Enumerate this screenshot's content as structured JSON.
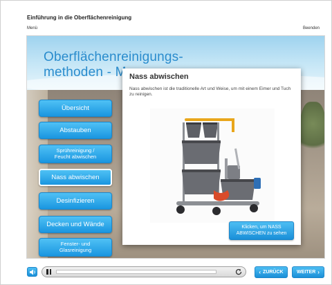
{
  "header": {
    "course_title": "Einführung in die Oberflächenreinigung",
    "menu_label": "Menü",
    "exit_label": "Beenden"
  },
  "stage": {
    "section_title_line1": "Oberflächenreinigungs-",
    "section_title_line2": "methoden - M"
  },
  "nav": {
    "items": [
      {
        "label": "Übersicht",
        "active": false
      },
      {
        "label": "Abstauben",
        "active": false
      },
      {
        "label_line1": "Sprühreinigung /",
        "label_line2": "Feucht abwischen",
        "active": false
      },
      {
        "label": "Nass abwischen",
        "active": true
      },
      {
        "label": "Desinfizieren",
        "active": false
      },
      {
        "label": "Decken und Wände",
        "active": false
      },
      {
        "label_line1": "Fenster- und",
        "label_line2": "Glasreinigung",
        "active": false
      }
    ]
  },
  "popup": {
    "title": "Nass abwischen",
    "text": "Nass abwischen ist die traditionelle Art und Weise, um mit einem Eimer und Tuch zu reinigen.",
    "see_button_line1": "Klicken, um NASS",
    "see_button_line2": "ABWISCHEN zu sehen",
    "image_icon": "cleaning-trolley-icon"
  },
  "controls": {
    "back_label": "ZURÜCK",
    "next_label": "WEITER",
    "progress_fraction": 0.0,
    "icons": [
      "speaker-icon",
      "pause-icon",
      "replay-icon",
      "chevron-left-icon",
      "chevron-right-icon"
    ]
  },
  "colors": {
    "accent": "#1a96e0",
    "title_blue": "#2a8ccd"
  }
}
